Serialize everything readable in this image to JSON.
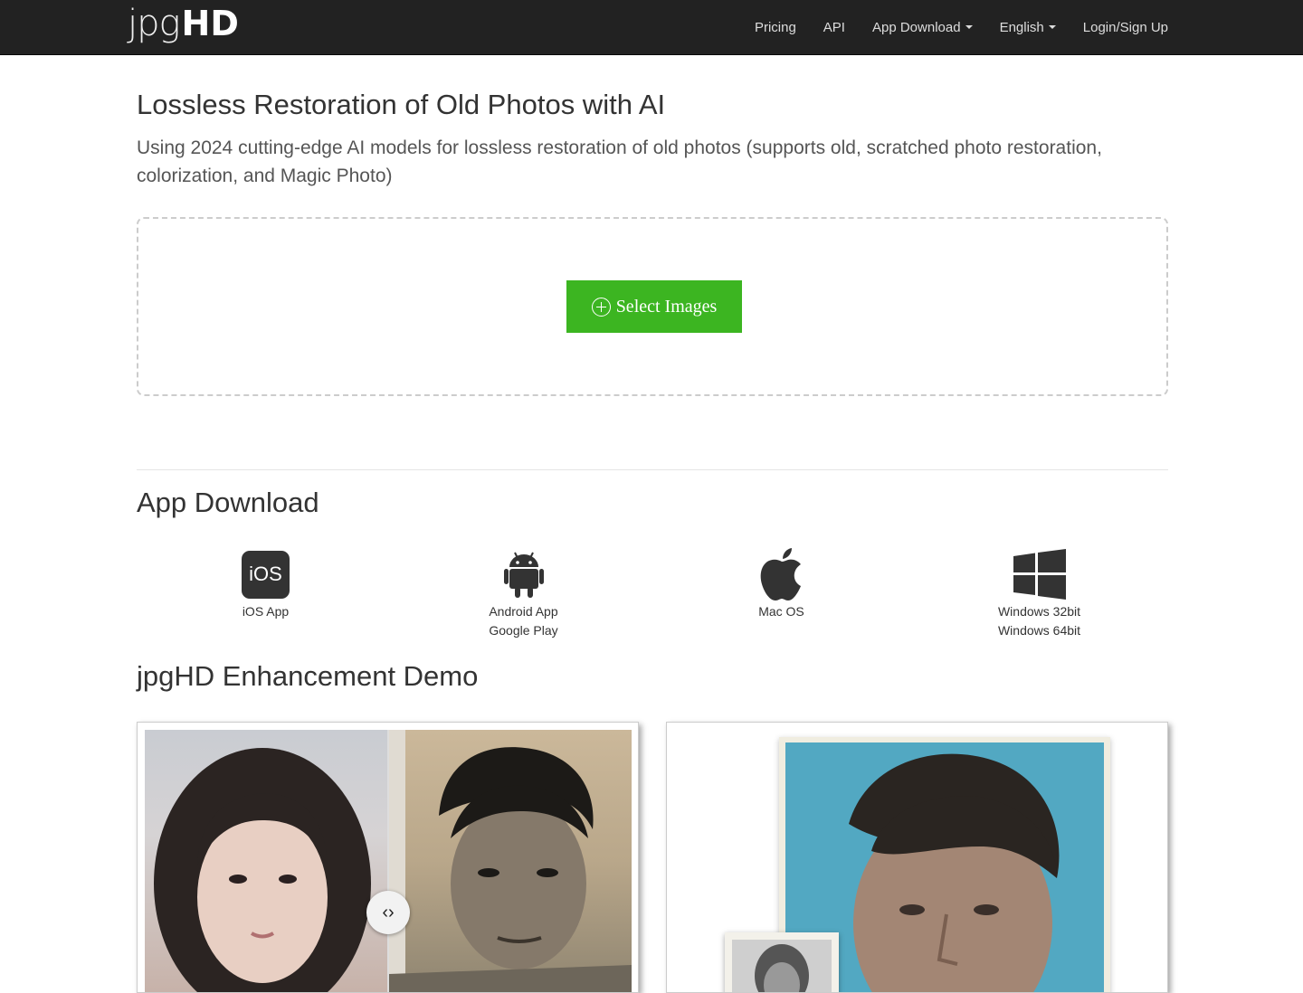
{
  "nav": {
    "logo_light": "jpg",
    "logo_bold": "HD",
    "links": [
      "Pricing",
      "API",
      "App Download",
      "English",
      "Login/Sign Up"
    ]
  },
  "hero": {
    "title": "Lossless Restoration of Old Photos with AI",
    "subtitle": "Using 2024 cutting-edge AI models for lossless restoration of old photos (supports old, scratched photo restoration, colorization, and Magic Photo)",
    "select_button": "Select Images"
  },
  "apps": {
    "title": "App Download",
    "ios_icon_text": "iOS",
    "items": [
      {
        "line1": "iOS App",
        "line2": ""
      },
      {
        "line1": "Android App",
        "line2": "Google Play"
      },
      {
        "line1": "Mac OS",
        "line2": ""
      },
      {
        "line1": "Windows 32bit",
        "line2": "Windows 64bit"
      }
    ]
  },
  "demo": {
    "title": "jpgHD Enhancement Demo"
  },
  "colors": {
    "navbar": "#222222",
    "accent_green": "#3cb521"
  }
}
